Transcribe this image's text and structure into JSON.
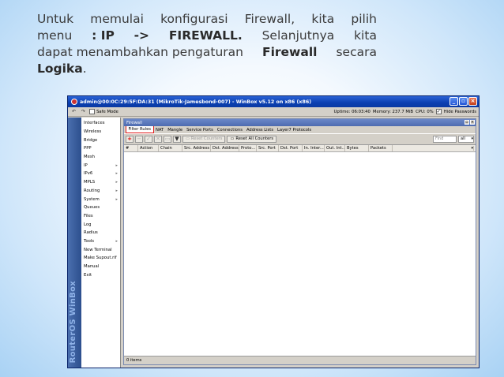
{
  "slide": {
    "line1": [
      "Untuk",
      "memulai",
      "konfigurasi",
      "Firewall,",
      "kita",
      "pilih"
    ],
    "line2": {
      "w1": "menu",
      "w2": ": IP",
      "w3": "->",
      "w4": "FIREWALL.",
      "w5": "Selanjutnya",
      "w6": "kita"
    },
    "line3": {
      "pre": "dapat menambahkan pengaturan",
      "bold": "Firewall",
      "post": "secara"
    },
    "line4": {
      "bold": "Logika",
      "post": "."
    }
  },
  "window": {
    "title": "admin@00:0C:29:5F:DA:31 (MikroTik-Jamesbond-007) - WinBox v5.12 on x86 (x86)",
    "controls": [
      "_",
      "▫",
      "×"
    ],
    "toolbar": {
      "undo": "↶",
      "redo": "↷",
      "safe_mode": "Safe Mode",
      "uptime": "Uptime: 06:03:40",
      "memory": "Memory: 237.7 MiB",
      "cpu": "CPU: 0%",
      "hide_passwords": "Hide Passwords",
      "hide_passwords_checked": "✓"
    },
    "sidebar_label": "RouterOS WinBox",
    "menu": [
      {
        "label": "Interfaces",
        "arrow": ""
      },
      {
        "label": "Wireless",
        "arrow": ""
      },
      {
        "label": "Bridge",
        "arrow": ""
      },
      {
        "label": "PPP",
        "arrow": ""
      },
      {
        "label": "Mesh",
        "arrow": ""
      },
      {
        "label": "IP",
        "arrow": "▸"
      },
      {
        "label": "IPv6",
        "arrow": "▸"
      },
      {
        "label": "MPLS",
        "arrow": "▸"
      },
      {
        "label": "Routing",
        "arrow": "▸"
      },
      {
        "label": "System",
        "arrow": "▸"
      },
      {
        "label": "Queues",
        "arrow": ""
      },
      {
        "label": "Files",
        "arrow": ""
      },
      {
        "label": "Log",
        "arrow": ""
      },
      {
        "label": "Radius",
        "arrow": ""
      },
      {
        "label": "Tools",
        "arrow": "▸"
      },
      {
        "label": "New Terminal",
        "arrow": ""
      },
      {
        "label": "Make Supout.rif",
        "arrow": ""
      },
      {
        "label": "Manual",
        "arrow": ""
      },
      {
        "label": "Exit",
        "arrow": ""
      }
    ],
    "firewall": {
      "title": "Firewall",
      "tabs": [
        "Filter Rules",
        "NAT",
        "Mangle",
        "Service Ports",
        "Connections",
        "Address Lists",
        "Layer7 Protocols"
      ],
      "actions": {
        "add": "+",
        "remove": "−",
        "enable": "✓",
        "disable": "✕",
        "comment": "▭",
        "filter": "▼",
        "reset_counters": "Reset Counters",
        "reset_all_counters": "Reset All Counters",
        "find_placeholder": "Find",
        "filter_select": "all"
      },
      "columns": [
        "#",
        "Action",
        "Chain",
        "Src. Address",
        "Dst. Address",
        "Proto...",
        "Src. Port",
        "Dst. Port",
        "In. Inter...",
        "Out. Int...",
        "Bytes",
        "Packets"
      ],
      "status": "0 items"
    }
  }
}
